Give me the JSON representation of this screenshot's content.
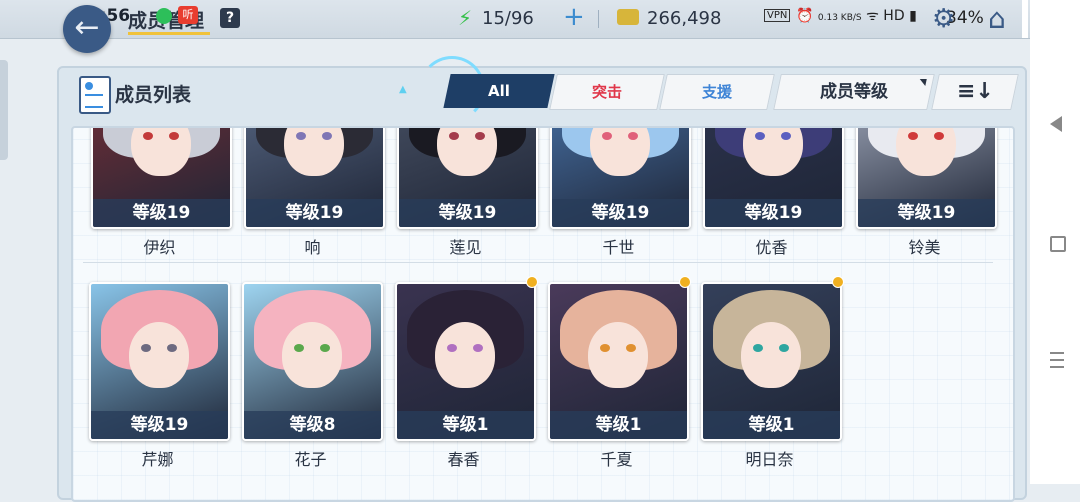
{
  "status_bar": {
    "time": "02:56",
    "vpn": "VPN",
    "speed": "0.13 KB/S",
    "battery": "34%"
  },
  "header": {
    "title": "成员管理",
    "help": "?",
    "ap": "15/96",
    "plus": "+",
    "credits": "266,498"
  },
  "panel": {
    "title": "成员列表",
    "tabs": {
      "all": "All",
      "striker": "突击",
      "special": "支援"
    },
    "sort_label": "成员等级",
    "order_icon": "≡↓"
  },
  "students_row1": [
    {
      "name": "伊织",
      "level": "等级19",
      "hair": "#c9ccd6",
      "bg": "#7a2f37",
      "eye": "#c33a3a"
    },
    {
      "name": "响",
      "level": "等级19",
      "hair": "#2b2b35",
      "bg": "#5b6b88",
      "eye": "#7f76b5"
    },
    {
      "name": "莲见",
      "level": "等级19",
      "hair": "#1a1a22",
      "bg": "#4a5366",
      "eye": "#a43c4c"
    },
    {
      "name": "千世",
      "level": "等级19",
      "hair": "#9cc7ee",
      "bg": "#4b78b0",
      "eye": "#e0607a"
    },
    {
      "name": "优香",
      "level": "等级19",
      "hair": "#3d3d78",
      "bg": "#2e3550",
      "eye": "#5b5fc0"
    },
    {
      "name": "铃美",
      "level": "等级19",
      "hair": "#e8eaf0",
      "bg": "#aab2c4",
      "eye": "#d03a3a"
    }
  ],
  "students_row2": [
    {
      "name": "芹娜",
      "level": "等级19",
      "hair": "#f2a6b2",
      "bg": "#89c4e8",
      "eye": "#6d6a80",
      "new": false
    },
    {
      "name": "花子",
      "level": "等级8",
      "hair": "#f5b3c0",
      "bg": "#9ed4f0",
      "eye": "#5aa84c",
      "new": false
    },
    {
      "name": "春香",
      "level": "等级1",
      "hair": "#2a2236",
      "bg": "#3a3350",
      "eye": "#b070c0",
      "new": true
    },
    {
      "name": "千夏",
      "level": "等级1",
      "hair": "#e6b39c",
      "bg": "#4a3a5a",
      "eye": "#e09030",
      "new": true
    },
    {
      "name": "明日奈",
      "level": "等级1",
      "hair": "#c7b59a",
      "bg": "#34405a",
      "eye": "#2ea6a0",
      "new": true
    }
  ]
}
